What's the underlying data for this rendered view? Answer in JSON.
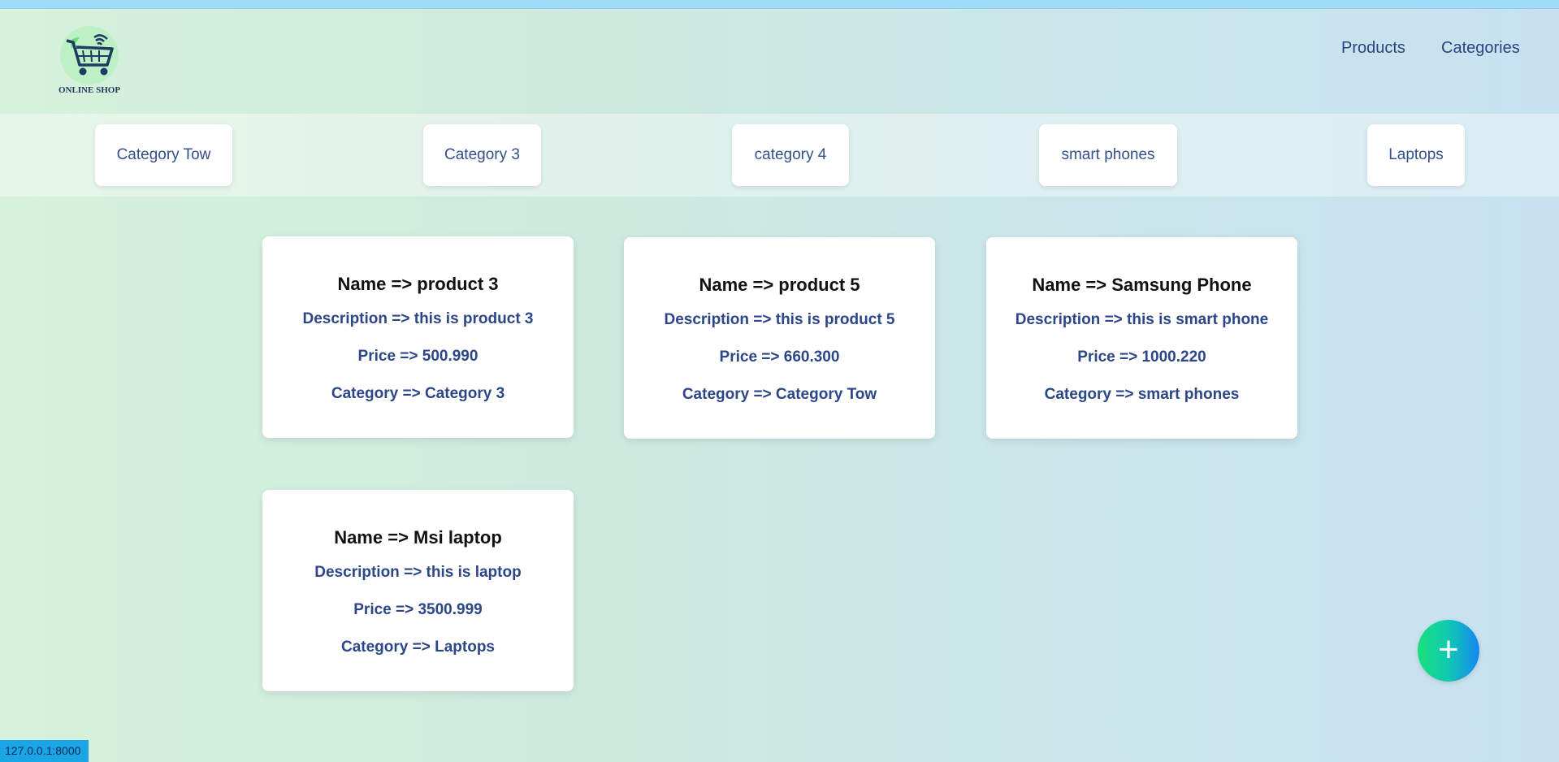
{
  "header": {
    "logo_text": "ONLINE SHOP",
    "nav": [
      {
        "label": "Products"
      },
      {
        "label": "Categories"
      }
    ]
  },
  "categories": [
    {
      "label": "Category Tow"
    },
    {
      "label": "Category 3"
    },
    {
      "label": "category 4"
    },
    {
      "label": "smart phones"
    },
    {
      "label": "Laptops"
    }
  ],
  "products": [
    {
      "name": "Name => product 3",
      "description": "Description => this is product 3",
      "price": "Price => 500.990",
      "category": "Category => Category 3"
    },
    {
      "name": "Name => product 5",
      "description": "Description => this is product 5",
      "price": "Price => 660.300",
      "category": "Category => Category Tow"
    },
    {
      "name": "Name => Samsung Phone",
      "description": "Description => this is smart phone",
      "price": "Price => 1000.220",
      "category": "Category => smart phones"
    },
    {
      "name": "Name => Msi laptop",
      "description": "Description => this is laptop",
      "price": "Price => 3500.999",
      "category": "Category => Laptops"
    }
  ],
  "fab": {
    "symbol": "+",
    "icon": "plus-icon"
  },
  "status_bar": {
    "url": "127.0.0.1:8000"
  },
  "colors": {
    "nav_text": "#2a4480",
    "card_text": "#2c4688",
    "fab_gradient_start": "#18e07a",
    "fab_gradient_end": "#1487f0",
    "status_bg": "#1aa5e6"
  }
}
